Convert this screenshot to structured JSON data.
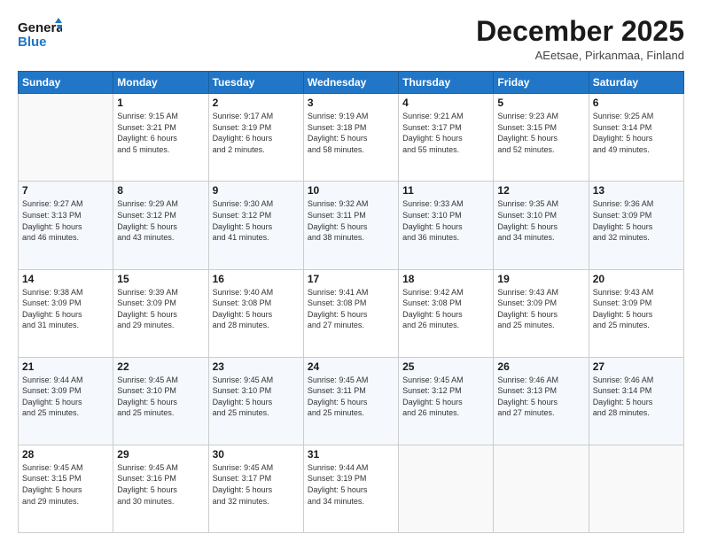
{
  "logo": {
    "line1": "General",
    "line2": "Blue"
  },
  "header": {
    "month": "December 2025",
    "location": "AEetsae, Pirkanmaa, Finland"
  },
  "weekdays": [
    "Sunday",
    "Monday",
    "Tuesday",
    "Wednesday",
    "Thursday",
    "Friday",
    "Saturday"
  ],
  "weeks": [
    [
      {
        "day": "",
        "info": ""
      },
      {
        "day": "1",
        "info": "Sunrise: 9:15 AM\nSunset: 3:21 PM\nDaylight: 6 hours\nand 5 minutes."
      },
      {
        "day": "2",
        "info": "Sunrise: 9:17 AM\nSunset: 3:19 PM\nDaylight: 6 hours\nand 2 minutes."
      },
      {
        "day": "3",
        "info": "Sunrise: 9:19 AM\nSunset: 3:18 PM\nDaylight: 5 hours\nand 58 minutes."
      },
      {
        "day": "4",
        "info": "Sunrise: 9:21 AM\nSunset: 3:17 PM\nDaylight: 5 hours\nand 55 minutes."
      },
      {
        "day": "5",
        "info": "Sunrise: 9:23 AM\nSunset: 3:15 PM\nDaylight: 5 hours\nand 52 minutes."
      },
      {
        "day": "6",
        "info": "Sunrise: 9:25 AM\nSunset: 3:14 PM\nDaylight: 5 hours\nand 49 minutes."
      }
    ],
    [
      {
        "day": "7",
        "info": "Sunrise: 9:27 AM\nSunset: 3:13 PM\nDaylight: 5 hours\nand 46 minutes."
      },
      {
        "day": "8",
        "info": "Sunrise: 9:29 AM\nSunset: 3:12 PM\nDaylight: 5 hours\nand 43 minutes."
      },
      {
        "day": "9",
        "info": "Sunrise: 9:30 AM\nSunset: 3:12 PM\nDaylight: 5 hours\nand 41 minutes."
      },
      {
        "day": "10",
        "info": "Sunrise: 9:32 AM\nSunset: 3:11 PM\nDaylight: 5 hours\nand 38 minutes."
      },
      {
        "day": "11",
        "info": "Sunrise: 9:33 AM\nSunset: 3:10 PM\nDaylight: 5 hours\nand 36 minutes."
      },
      {
        "day": "12",
        "info": "Sunrise: 9:35 AM\nSunset: 3:10 PM\nDaylight: 5 hours\nand 34 minutes."
      },
      {
        "day": "13",
        "info": "Sunrise: 9:36 AM\nSunset: 3:09 PM\nDaylight: 5 hours\nand 32 minutes."
      }
    ],
    [
      {
        "day": "14",
        "info": "Sunrise: 9:38 AM\nSunset: 3:09 PM\nDaylight: 5 hours\nand 31 minutes."
      },
      {
        "day": "15",
        "info": "Sunrise: 9:39 AM\nSunset: 3:09 PM\nDaylight: 5 hours\nand 29 minutes."
      },
      {
        "day": "16",
        "info": "Sunrise: 9:40 AM\nSunset: 3:08 PM\nDaylight: 5 hours\nand 28 minutes."
      },
      {
        "day": "17",
        "info": "Sunrise: 9:41 AM\nSunset: 3:08 PM\nDaylight: 5 hours\nand 27 minutes."
      },
      {
        "day": "18",
        "info": "Sunrise: 9:42 AM\nSunset: 3:08 PM\nDaylight: 5 hours\nand 26 minutes."
      },
      {
        "day": "19",
        "info": "Sunrise: 9:43 AM\nSunset: 3:09 PM\nDaylight: 5 hours\nand 25 minutes."
      },
      {
        "day": "20",
        "info": "Sunrise: 9:43 AM\nSunset: 3:09 PM\nDaylight: 5 hours\nand 25 minutes."
      }
    ],
    [
      {
        "day": "21",
        "info": "Sunrise: 9:44 AM\nSunset: 3:09 PM\nDaylight: 5 hours\nand 25 minutes."
      },
      {
        "day": "22",
        "info": "Sunrise: 9:45 AM\nSunset: 3:10 PM\nDaylight: 5 hours\nand 25 minutes."
      },
      {
        "day": "23",
        "info": "Sunrise: 9:45 AM\nSunset: 3:10 PM\nDaylight: 5 hours\nand 25 minutes."
      },
      {
        "day": "24",
        "info": "Sunrise: 9:45 AM\nSunset: 3:11 PM\nDaylight: 5 hours\nand 25 minutes."
      },
      {
        "day": "25",
        "info": "Sunrise: 9:45 AM\nSunset: 3:12 PM\nDaylight: 5 hours\nand 26 minutes."
      },
      {
        "day": "26",
        "info": "Sunrise: 9:46 AM\nSunset: 3:13 PM\nDaylight: 5 hours\nand 27 minutes."
      },
      {
        "day": "27",
        "info": "Sunrise: 9:46 AM\nSunset: 3:14 PM\nDaylight: 5 hours\nand 28 minutes."
      }
    ],
    [
      {
        "day": "28",
        "info": "Sunrise: 9:45 AM\nSunset: 3:15 PM\nDaylight: 5 hours\nand 29 minutes."
      },
      {
        "day": "29",
        "info": "Sunrise: 9:45 AM\nSunset: 3:16 PM\nDaylight: 5 hours\nand 30 minutes."
      },
      {
        "day": "30",
        "info": "Sunrise: 9:45 AM\nSunset: 3:17 PM\nDaylight: 5 hours\nand 32 minutes."
      },
      {
        "day": "31",
        "info": "Sunrise: 9:44 AM\nSunset: 3:19 PM\nDaylight: 5 hours\nand 34 minutes."
      },
      {
        "day": "",
        "info": ""
      },
      {
        "day": "",
        "info": ""
      },
      {
        "day": "",
        "info": ""
      }
    ]
  ]
}
